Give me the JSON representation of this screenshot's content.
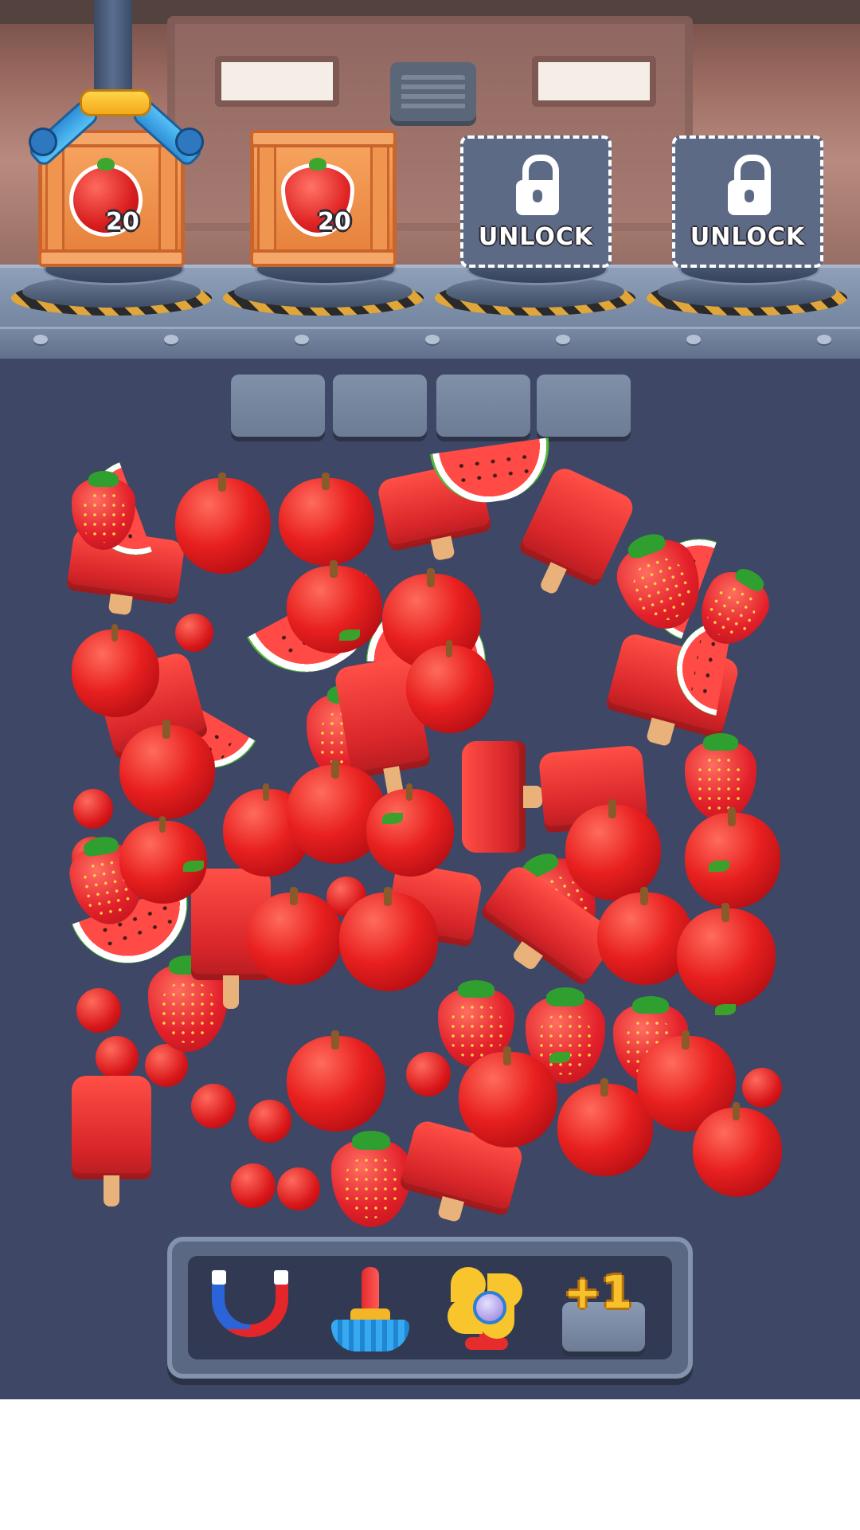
{
  "crates": [
    {
      "fruit": "apple",
      "fruit_icon": "apple-icon",
      "count": "20"
    },
    {
      "fruit": "strawberry",
      "fruit_icon": "strawberry-icon",
      "count": "20"
    }
  ],
  "locked_slots": [
    {
      "label": "UNLOCK",
      "icon": "lock-icon"
    },
    {
      "label": "UNLOCK",
      "icon": "lock-icon"
    }
  ],
  "collection_slots": 4,
  "pile": {
    "item_types": [
      "apple",
      "strawberry",
      "watermelon",
      "popsicle",
      "cherry"
    ]
  },
  "tools": [
    {
      "name": "magnet",
      "icon": "magnet-icon"
    },
    {
      "name": "broom",
      "icon": "broom-icon"
    },
    {
      "name": "fan",
      "icon": "fan-icon"
    },
    {
      "name": "add-slot",
      "label": "+1"
    }
  ],
  "colors": {
    "accent_red": "#e8201f",
    "crate_orange": "#f7a45f",
    "panel_slate": "#3e4766"
  }
}
